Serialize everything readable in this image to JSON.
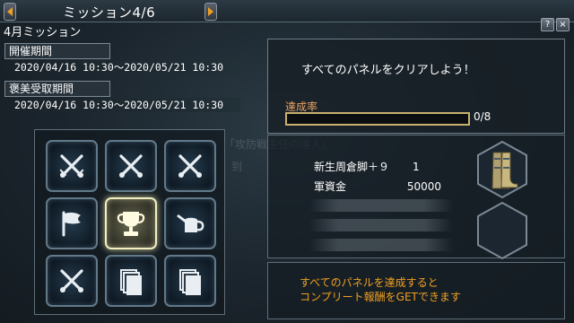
{
  "header": {
    "title": "ミッション4/6",
    "subtitle": "4月ミッション",
    "help_label": "?",
    "close_label": "×"
  },
  "period": {
    "label": "開催期間",
    "range": "2020/04/16 10:30～2020/05/21 10:30"
  },
  "reward_period": {
    "label": "褒美受取期間",
    "range": "2020/04/16 10:30～2020/05/21 10:30"
  },
  "tiles": [
    {
      "icon": "crossed-swords-icon",
      "active": false
    },
    {
      "icon": "crossed-swords-icon",
      "active": false
    },
    {
      "icon": "crossed-swords-icon",
      "active": false
    },
    {
      "icon": "flag-icon",
      "active": false
    },
    {
      "icon": "trophy-icon",
      "active": true
    },
    {
      "icon": "watering-can-icon",
      "active": false
    },
    {
      "icon": "crossed-swords-icon",
      "active": false
    },
    {
      "icon": "cards-stack-icon",
      "active": false
    },
    {
      "icon": "cards-stack-icon",
      "active": false
    }
  ],
  "ghost_text": {
    "line1": "「攻防戦主任の達人」",
    "line2": "到"
  },
  "mission": {
    "description": "すべてのパネルをクリアしよう！",
    "achievement_label": "達成率",
    "progress_text": "0/8",
    "progress_fraction": 0.0
  },
  "rewards": {
    "items": [
      {
        "name": "新生周倉脚＋９",
        "qty": "1"
      },
      {
        "name": "軍資金",
        "qty": "50000"
      }
    ],
    "icons": [
      "boots-icon",
      "empty-slot-icon"
    ]
  },
  "footer": {
    "line1": "すべてのパネルを達成すると",
    "line2": "コンプリート報酬をGETできます"
  },
  "colors": {
    "accent_orange": "#f0a020",
    "achievement_label": "#e9a060",
    "progress_border": "#c9b070",
    "tile_border": "#62798a",
    "tile_active_border": "#f2f0c0"
  }
}
